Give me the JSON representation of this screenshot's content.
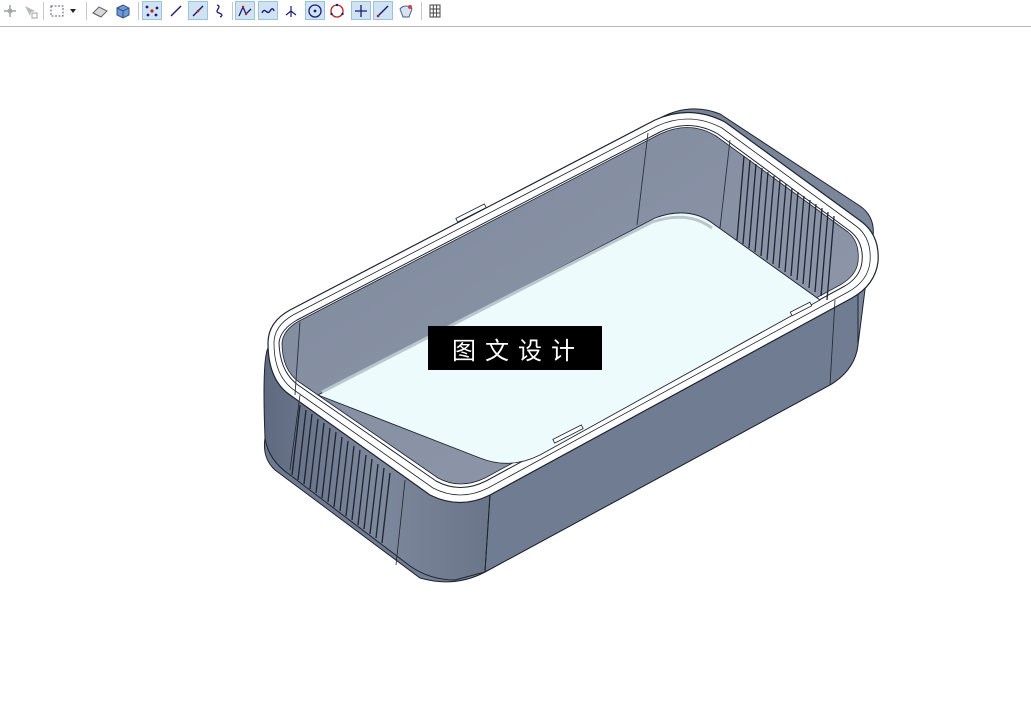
{
  "toolbar": {
    "buttons": [
      {
        "name": "snap-point-icon",
        "active": false
      },
      {
        "name": "snap-cursor-icon",
        "active": false
      },
      {
        "name": "select-box-icon",
        "active": false
      },
      {
        "name": "dropdown-arrow-icon",
        "active": false
      },
      {
        "name": "eraser-icon",
        "active": false
      },
      {
        "name": "solid-cube-icon",
        "active": false
      },
      {
        "name": "points-cloud-icon",
        "active": true
      },
      {
        "name": "line-icon",
        "active": false
      },
      {
        "name": "line-two-point-icon",
        "active": true
      },
      {
        "name": "spline-icon",
        "active": false
      },
      {
        "name": "polyline-icon",
        "active": true
      },
      {
        "name": "curve-icon",
        "active": true
      },
      {
        "name": "axis-icon",
        "active": false
      },
      {
        "name": "circle-center-icon",
        "active": true
      },
      {
        "name": "circle-points-icon",
        "active": false
      },
      {
        "name": "cross-icon",
        "active": true
      },
      {
        "name": "diagonal-line-icon",
        "active": true
      },
      {
        "name": "surface-icon",
        "active": false
      },
      {
        "name": "grid-icon",
        "active": false
      }
    ]
  },
  "viewport": {
    "model": "rounded-rectangular-tray",
    "colors": {
      "outer_wall": "#6f7b91",
      "inner_wall": "#8a93a6",
      "floor": "#eefbfc",
      "rim": "#ffffff",
      "edge": "#1e2430"
    }
  },
  "watermark": {
    "text": "图文设计"
  }
}
